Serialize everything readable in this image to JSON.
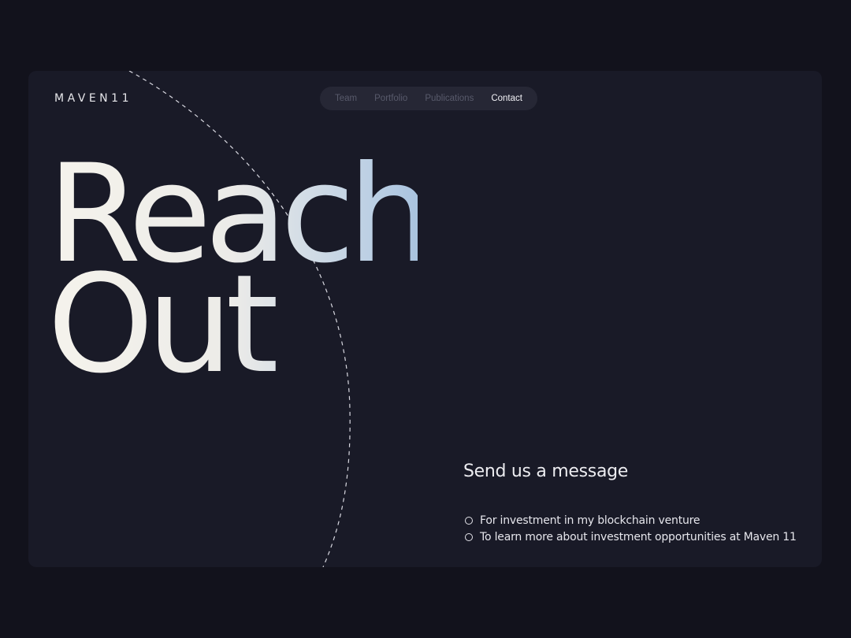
{
  "brand": {
    "logo_text": "MAVEN11"
  },
  "nav": {
    "items": [
      {
        "label": "Team"
      },
      {
        "label": "Portfolio"
      },
      {
        "label": "Publications"
      },
      {
        "label": "Contact"
      }
    ],
    "active": "Contact"
  },
  "hero": {
    "line1": "Reach",
    "line2": "Out"
  },
  "contact": {
    "title": "Send us a message",
    "options": [
      {
        "label": "For investment in my blockchain venture",
        "selected": false
      },
      {
        "label": "To learn more about investment opportunities at Maven 11",
        "selected": false
      }
    ]
  },
  "colors": {
    "page_background": "#12121c",
    "card_background": "#191a27",
    "nav_background": "#262735",
    "text_primary": "#ececf0",
    "text_muted": "#585a6b",
    "gradient_start": "#f5f3ec",
    "gradient_end": "#a9c3de"
  },
  "icons": {
    "radio": "radio-circle-outline",
    "decoration": "dashed-arc"
  }
}
